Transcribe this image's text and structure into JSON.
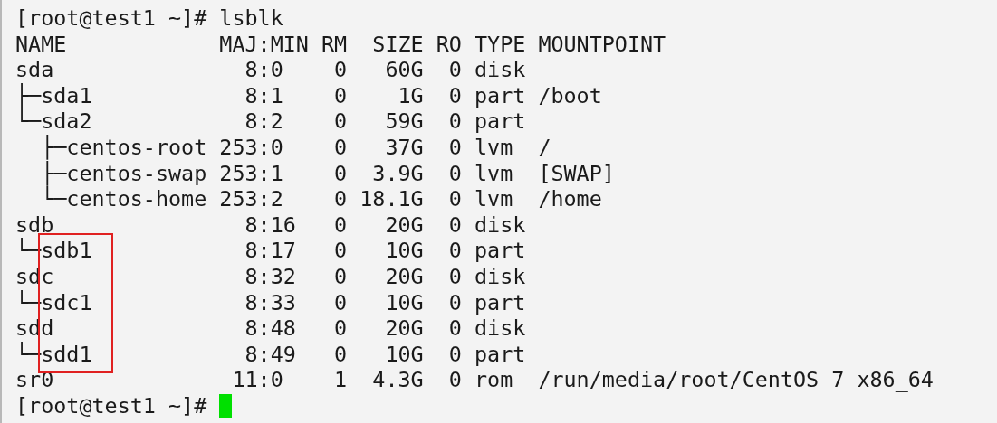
{
  "terminal": {
    "command_prompt": "[root@test1 ~]#",
    "command": "lsblk",
    "output_lines": [
      "NAME            MAJ:MIN RM  SIZE RO TYPE MOUNTPOINT",
      "sda               8:0    0   60G  0 disk ",
      "├─sda1            8:1    0    1G  0 part /boot",
      "└─sda2            8:2    0   59G  0 part ",
      "  ├─centos-root 253:0    0   37G  0 lvm  /",
      "  ├─centos-swap 253:1    0  3.9G  0 lvm  [SWAP]",
      "  └─centos-home 253:2    0 18.1G  0 lvm  /home",
      "sdb               8:16   0   20G  0 disk ",
      "└─sdb1            8:17   0   10G  0 part ",
      "sdc               8:32   0   20G  0 disk ",
      "└─sdc1            8:33   0   10G  0 part ",
      "sdd               8:48   0   20G  0 disk ",
      "└─sdd1            8:49   0   10G  0 part ",
      "sr0              11:0    1  4.3G  0 rom  /run/media/root/CentOS 7 x86_64"
    ],
    "final_prompt": "[root@test1 ~]#"
  },
  "annotation": {
    "kind": "highlight-box",
    "color": "#e02020"
  }
}
